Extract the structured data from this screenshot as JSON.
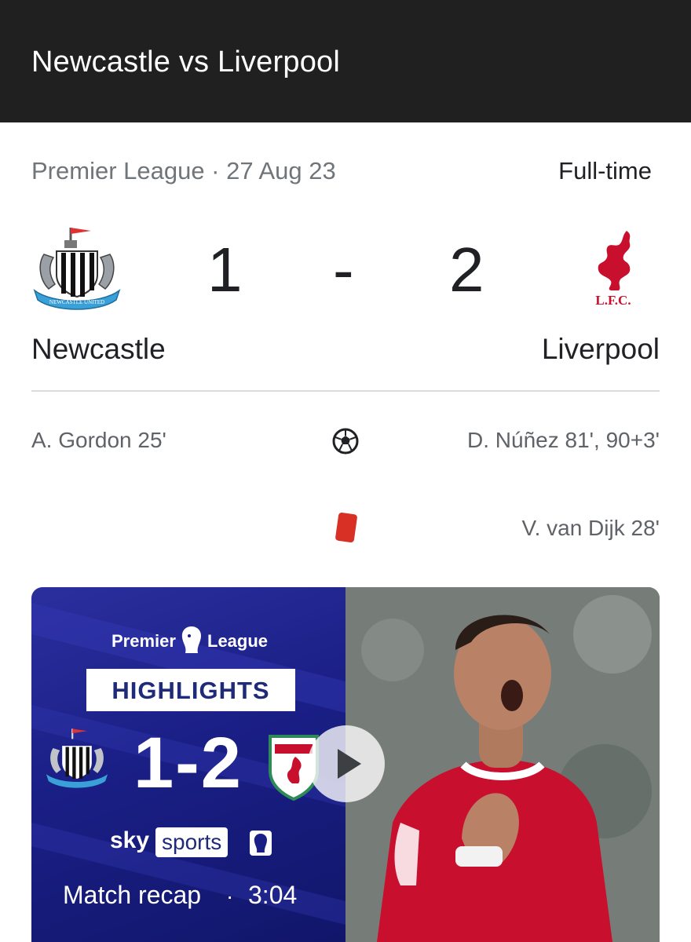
{
  "header": {
    "title": "Newcastle vs Liverpool"
  },
  "match": {
    "meta": "Premier League · 27 Aug 23",
    "status": "Full-time",
    "home": {
      "name": "Newcastle",
      "score": "1",
      "crest": "newcastle-crest"
    },
    "away": {
      "name": "Liverpool",
      "score": "2",
      "crest": "liverpool-crest"
    },
    "separator": "-"
  },
  "events": {
    "goals": {
      "icon": "soccer-ball-icon",
      "home": "A. Gordon 25'",
      "away": "D. Núñez 81', 90+3'"
    },
    "red_cards": {
      "icon": "red-card-icon",
      "color": "#d93025",
      "home": "",
      "away": "V. van Dijk 28'"
    }
  },
  "video": {
    "league_left": "Premier",
    "league_right": "League",
    "badge_text": "HIGHLIGHTS",
    "score": "1-2",
    "channel_sky": "sky",
    "channel_sports": "sports",
    "label": "Match recap",
    "separator": "·",
    "duration": "3:04",
    "play_icon": "play-icon"
  },
  "colors": {
    "topbar": "#202020",
    "video_blue": "#1a1f86",
    "liverpool_red": "#c8102e",
    "muted_text": "#5f6368"
  }
}
